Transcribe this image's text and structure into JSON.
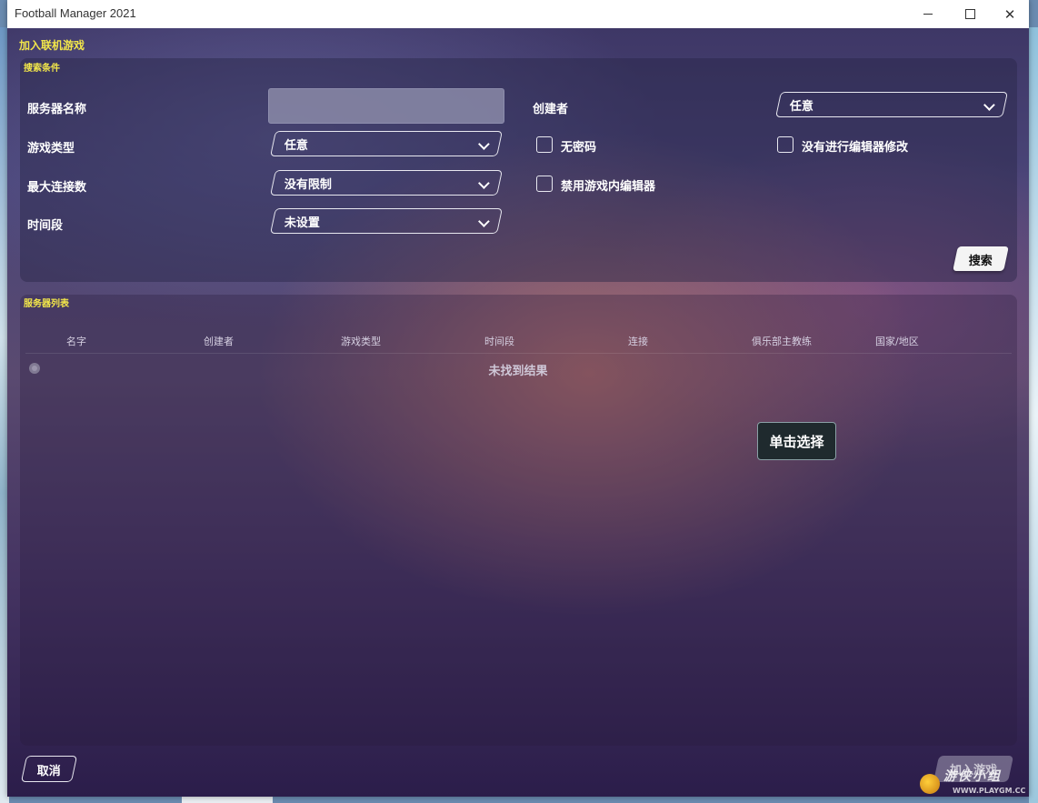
{
  "window": {
    "title": "Football Manager 2021"
  },
  "dialog": {
    "title": "加入联机游戏"
  },
  "search_panel": {
    "label": "搜索条件",
    "server_name_label": "服务器名称",
    "server_name_value": "",
    "creator_label": "创建者",
    "creator_value": "任意",
    "game_type_label": "游戏类型",
    "game_type_value": "任意",
    "max_connections_label": "最大连接数",
    "max_connections_value": "没有限制",
    "time_period_label": "时间段",
    "time_period_value": "未设置",
    "no_password_label": "无密码",
    "no_password_checked": false,
    "no_editor_mod_label": "没有进行编辑器修改",
    "no_editor_mod_checked": false,
    "disable_ingame_editor_label": "禁用游戏内编辑器",
    "disable_ingame_editor_checked": false,
    "search_button": "搜索"
  },
  "server_list": {
    "label": "服务器列表",
    "columns": [
      "名字",
      "创建者",
      "游戏类型",
      "时间段",
      "连接",
      "俱乐部主教练",
      "国家/地区"
    ],
    "empty_text": "未找到结果",
    "tooltip": "单击选择"
  },
  "footer": {
    "cancel_button": "取消",
    "join_button": "加入游戏"
  },
  "watermark": {
    "text": "游侠小组",
    "url": "WWW.PLAYGM.CC"
  },
  "colors": {
    "accent_yellow": "#f2e64a",
    "text_white": "#ffffff"
  }
}
